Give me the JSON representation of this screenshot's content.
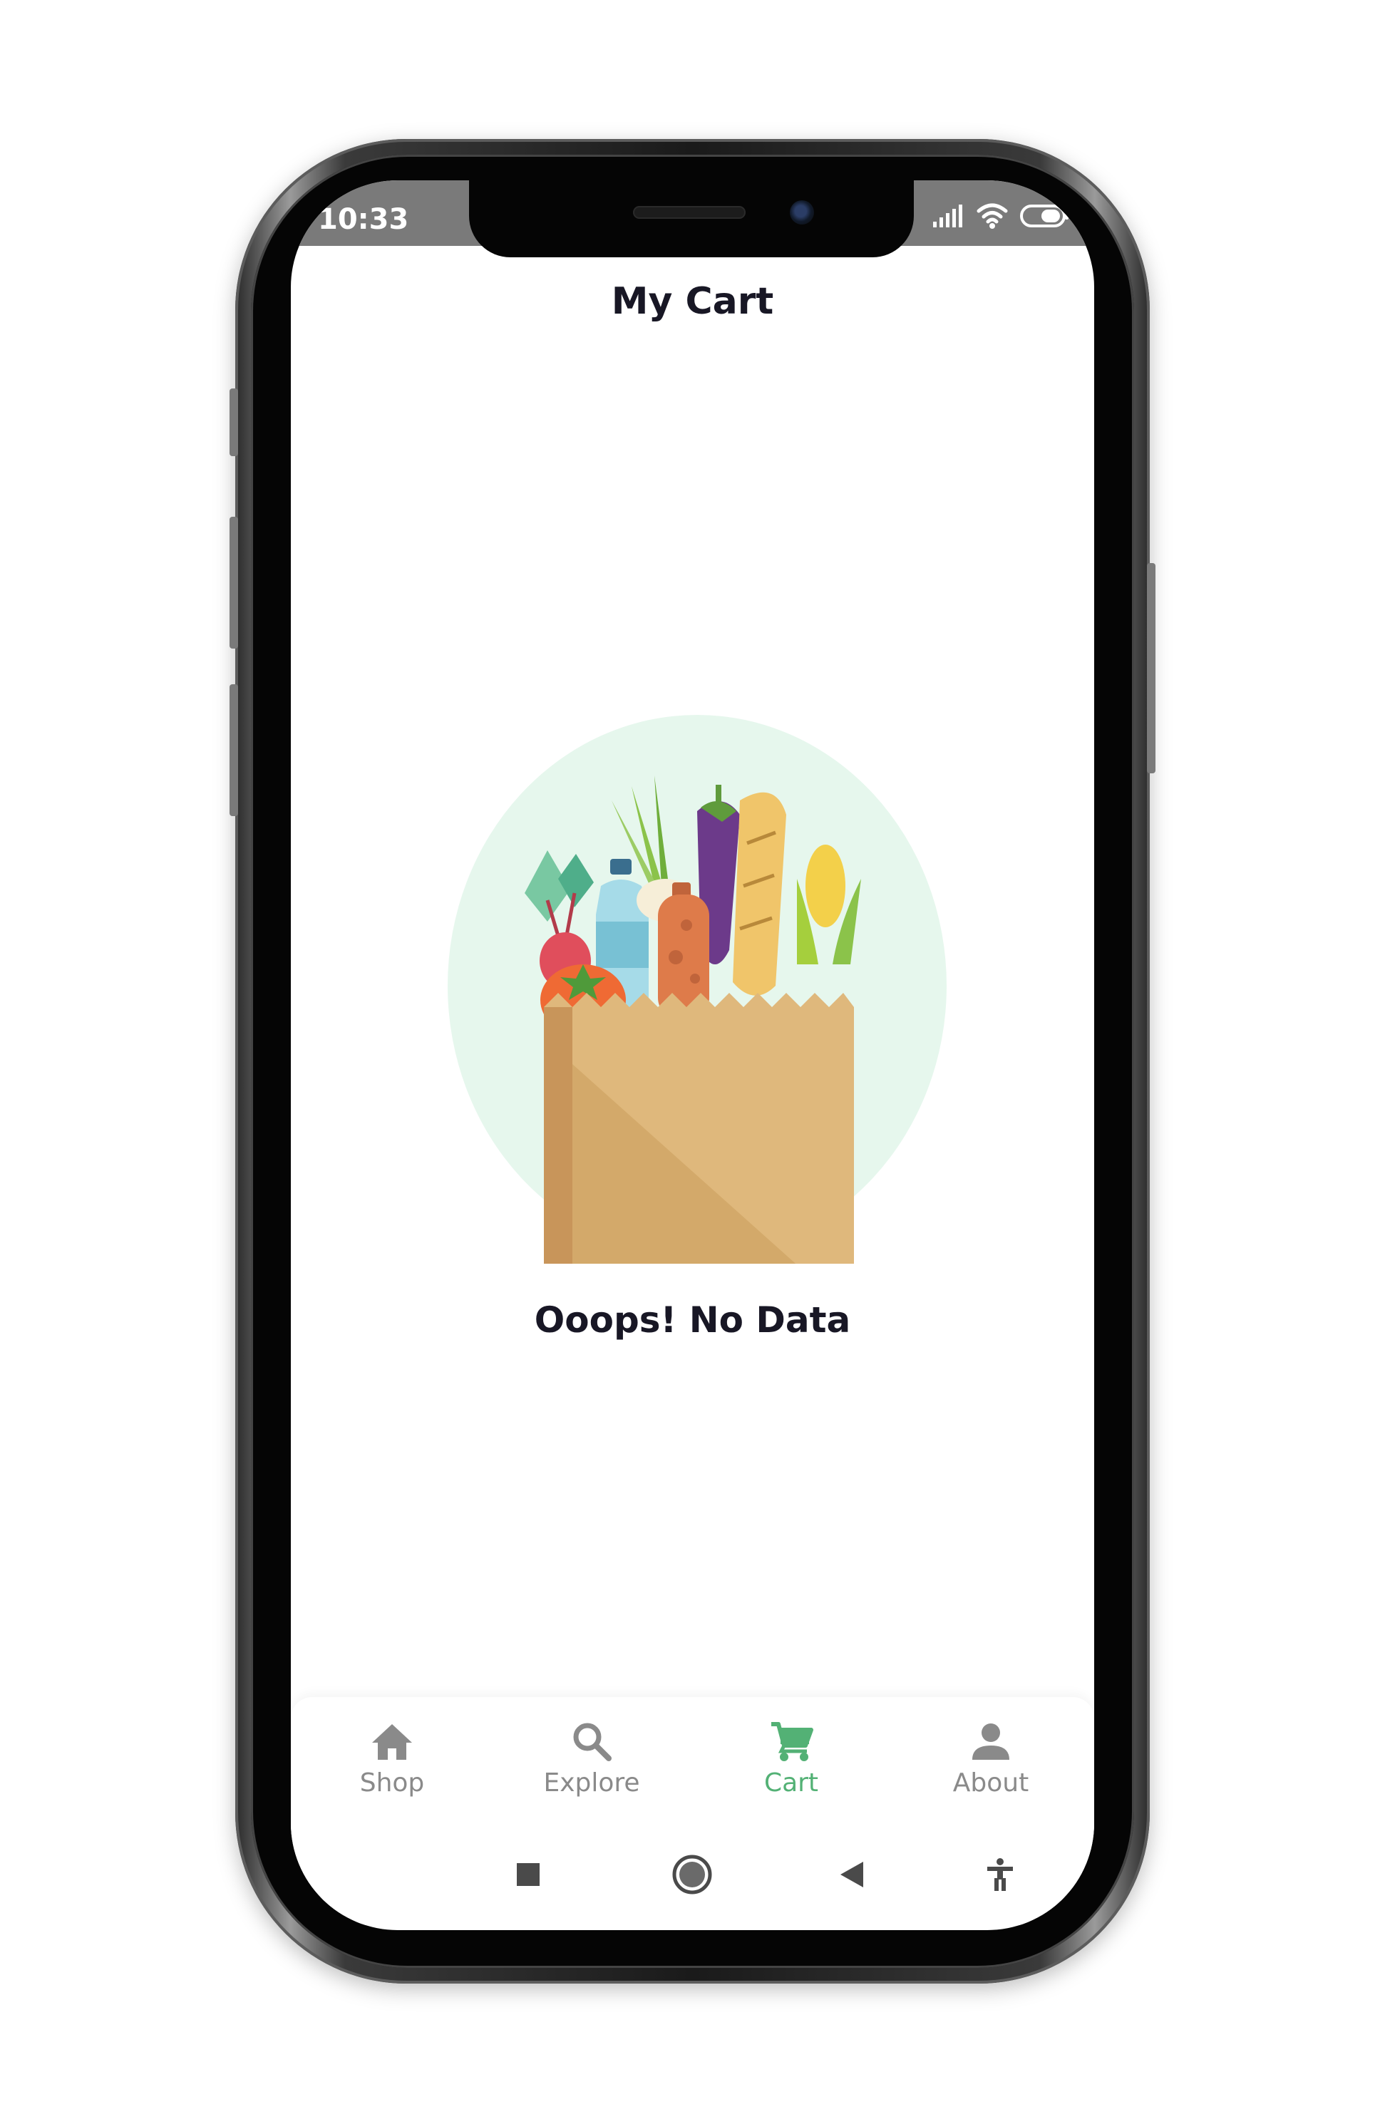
{
  "status_bar": {
    "time": "10:33"
  },
  "header": {
    "title": "My Cart"
  },
  "empty_state": {
    "illustration": "grocery-bag-illustration",
    "message": "Ooops! No Data"
  },
  "bottom_nav": {
    "items": [
      {
        "label": "Shop",
        "icon": "home-icon",
        "active": false
      },
      {
        "label": "Explore",
        "icon": "search-icon",
        "active": false
      },
      {
        "label": "Cart",
        "icon": "cart-icon",
        "active": true
      },
      {
        "label": "About",
        "icon": "person-icon",
        "active": false
      }
    ]
  },
  "android_nav": {
    "buttons": [
      "recents-square-icon",
      "home-circle-icon",
      "back-triangle-icon",
      "accessibility-icon"
    ]
  },
  "colors": {
    "accent": "#53b175",
    "text_dark": "#181725",
    "nav_inactive": "#8a8a8a",
    "status_bar": "#7a7a7a",
    "illustration_bg": "#e8f7ee"
  }
}
